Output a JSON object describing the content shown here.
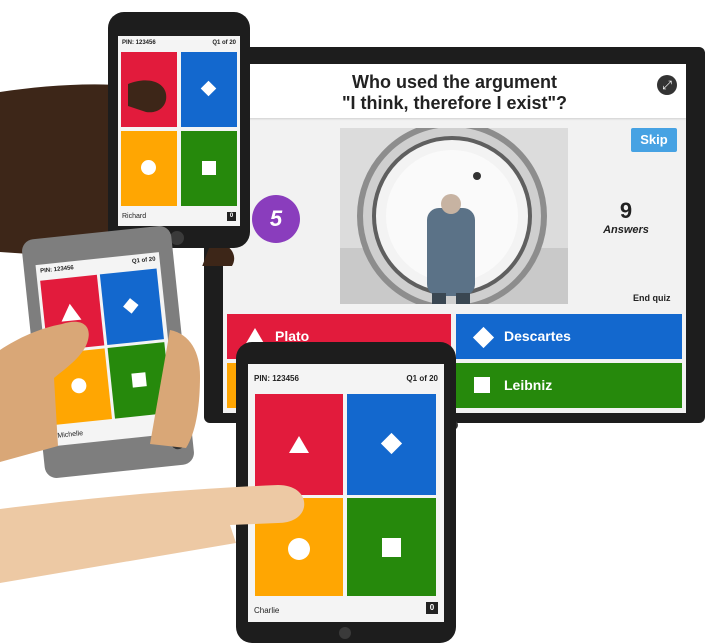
{
  "quiz": {
    "question_line1": "Who used the argument",
    "question_line2": "\"I think, therefore I exist\"?",
    "skip_label": "Skip",
    "timer": "5",
    "answers_count": "9",
    "answers_label": "Answers",
    "end_label": "End quiz",
    "fullscreen_icon": "⤢",
    "options": [
      {
        "label": "Plato",
        "color": "#e21b3c",
        "shape": "triangle"
      },
      {
        "label": "Descartes",
        "color": "#1368ce",
        "shape": "diamond"
      },
      {
        "label": "",
        "color": "#ffa602",
        "shape": "circle"
      },
      {
        "label": "Leibniz",
        "color": "#26890c",
        "shape": "square"
      }
    ]
  },
  "devices": {
    "phone_top": {
      "pin": "PIN: 123456",
      "progress": "Q1 of 20",
      "player": "Richard",
      "score": "0"
    },
    "phone_left": {
      "pin": "PIN: 123456",
      "progress": "Q1 of 20",
      "player": "Michelle",
      "score": "0"
    },
    "tablet": {
      "pin": "PIN: 123456",
      "progress": "Q1 of 20",
      "player": "Charlie",
      "score": "0"
    }
  },
  "colors": {
    "red": "#e21b3c",
    "blue": "#1368ce",
    "yellow": "#ffa602",
    "green": "#26890c",
    "purple": "#8a3dbd",
    "skip": "#46a2e3"
  }
}
